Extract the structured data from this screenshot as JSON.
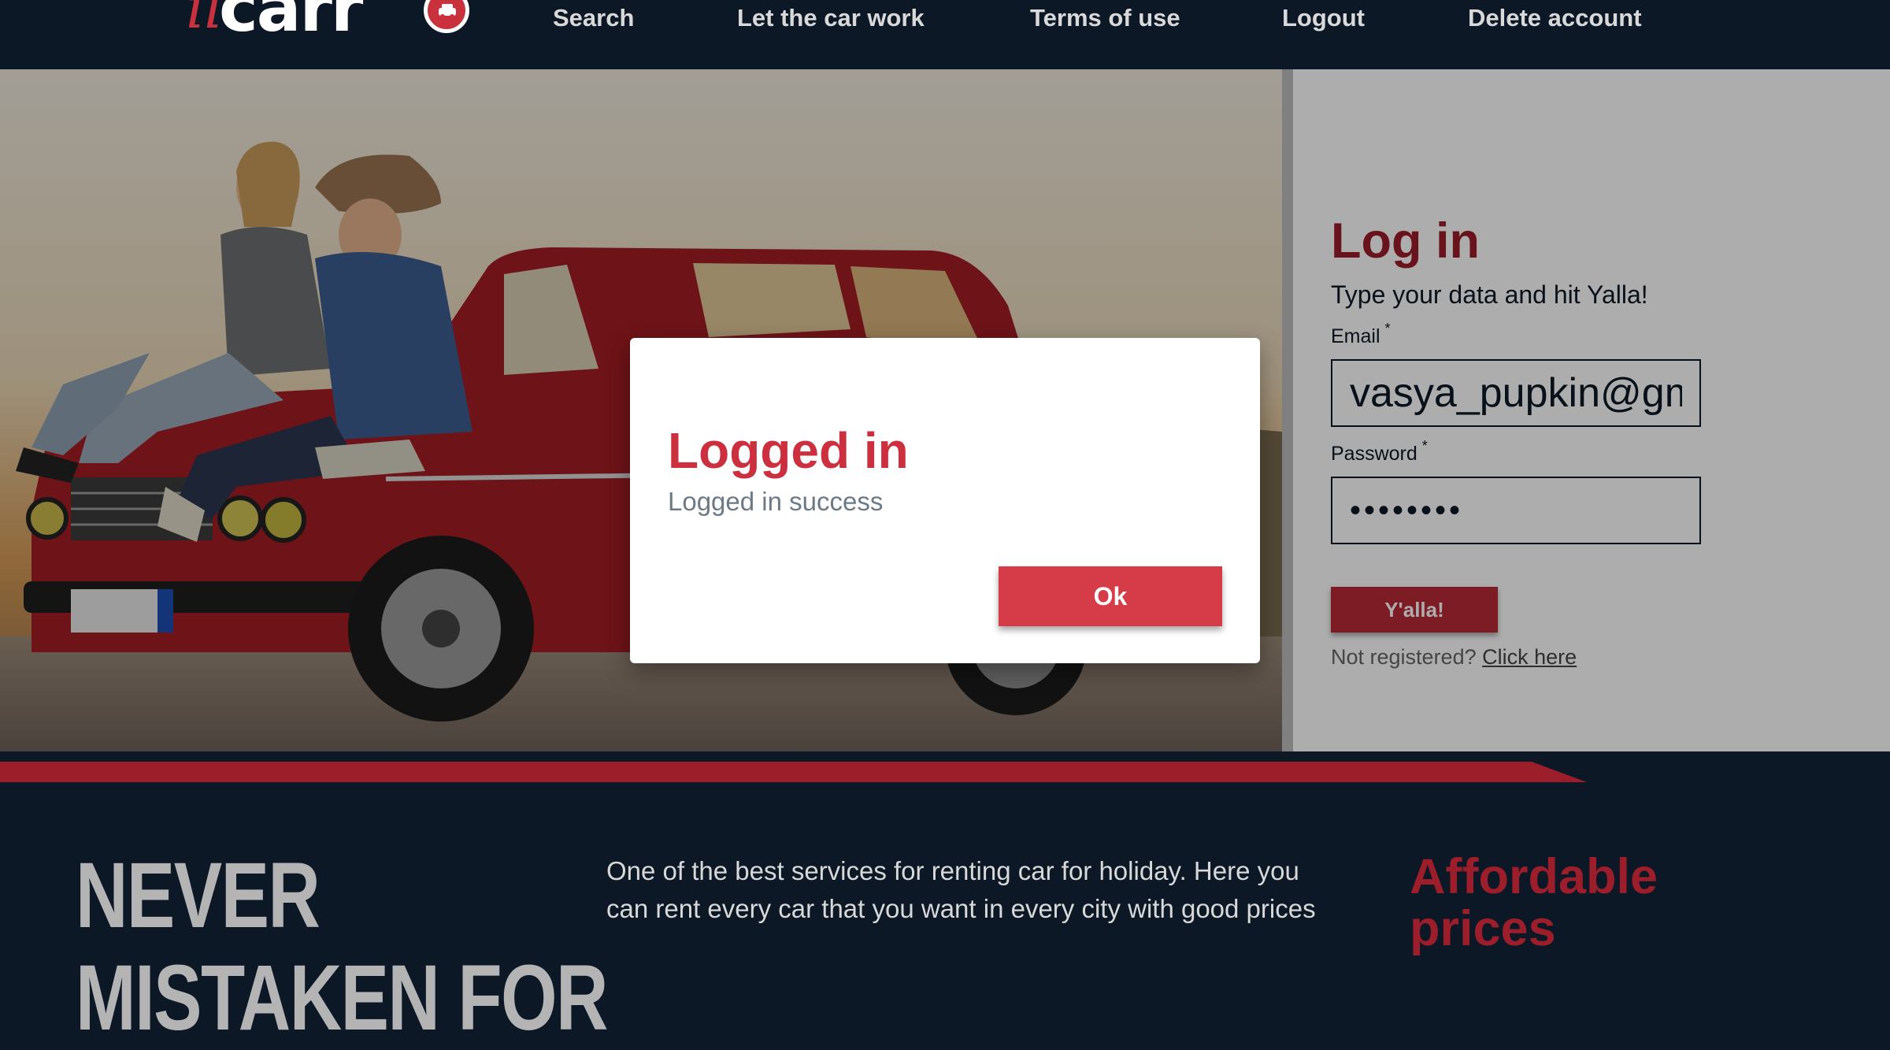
{
  "header": {
    "logo": {
      "prefix": "il",
      "main": "carr"
    },
    "nav": [
      {
        "label": "Search"
      },
      {
        "label": "Let the car work"
      },
      {
        "label": "Terms of use"
      },
      {
        "label": "Logout"
      },
      {
        "label": "Delete account"
      }
    ]
  },
  "login": {
    "title": "Log in",
    "subtitle": "Type your data and hit Yalla!",
    "email_label": "Email",
    "email_value": "vasya_pupkin@gm",
    "password_label": "Password",
    "password_value": "••••••••",
    "required_mark": "*",
    "submit_label": "Y'alla!",
    "not_registered": "Not registered?",
    "register_link": "Click here"
  },
  "modal": {
    "title": "Logged in",
    "message": "Logged in success",
    "ok_label": "Ok"
  },
  "footer": {
    "slogan_line1": "NEVER",
    "slogan_line2": "MISTAKEN FOR",
    "description": "One of the best services for renting car for holiday. Here you can rent every car that you want in every city with good prices",
    "feature_title": "Affordable prices"
  },
  "colors": {
    "navy": "#0c1826",
    "brand_red": "#9b1e2a",
    "modal_red": "#cc2f3d",
    "ok_red": "#d63c47"
  }
}
